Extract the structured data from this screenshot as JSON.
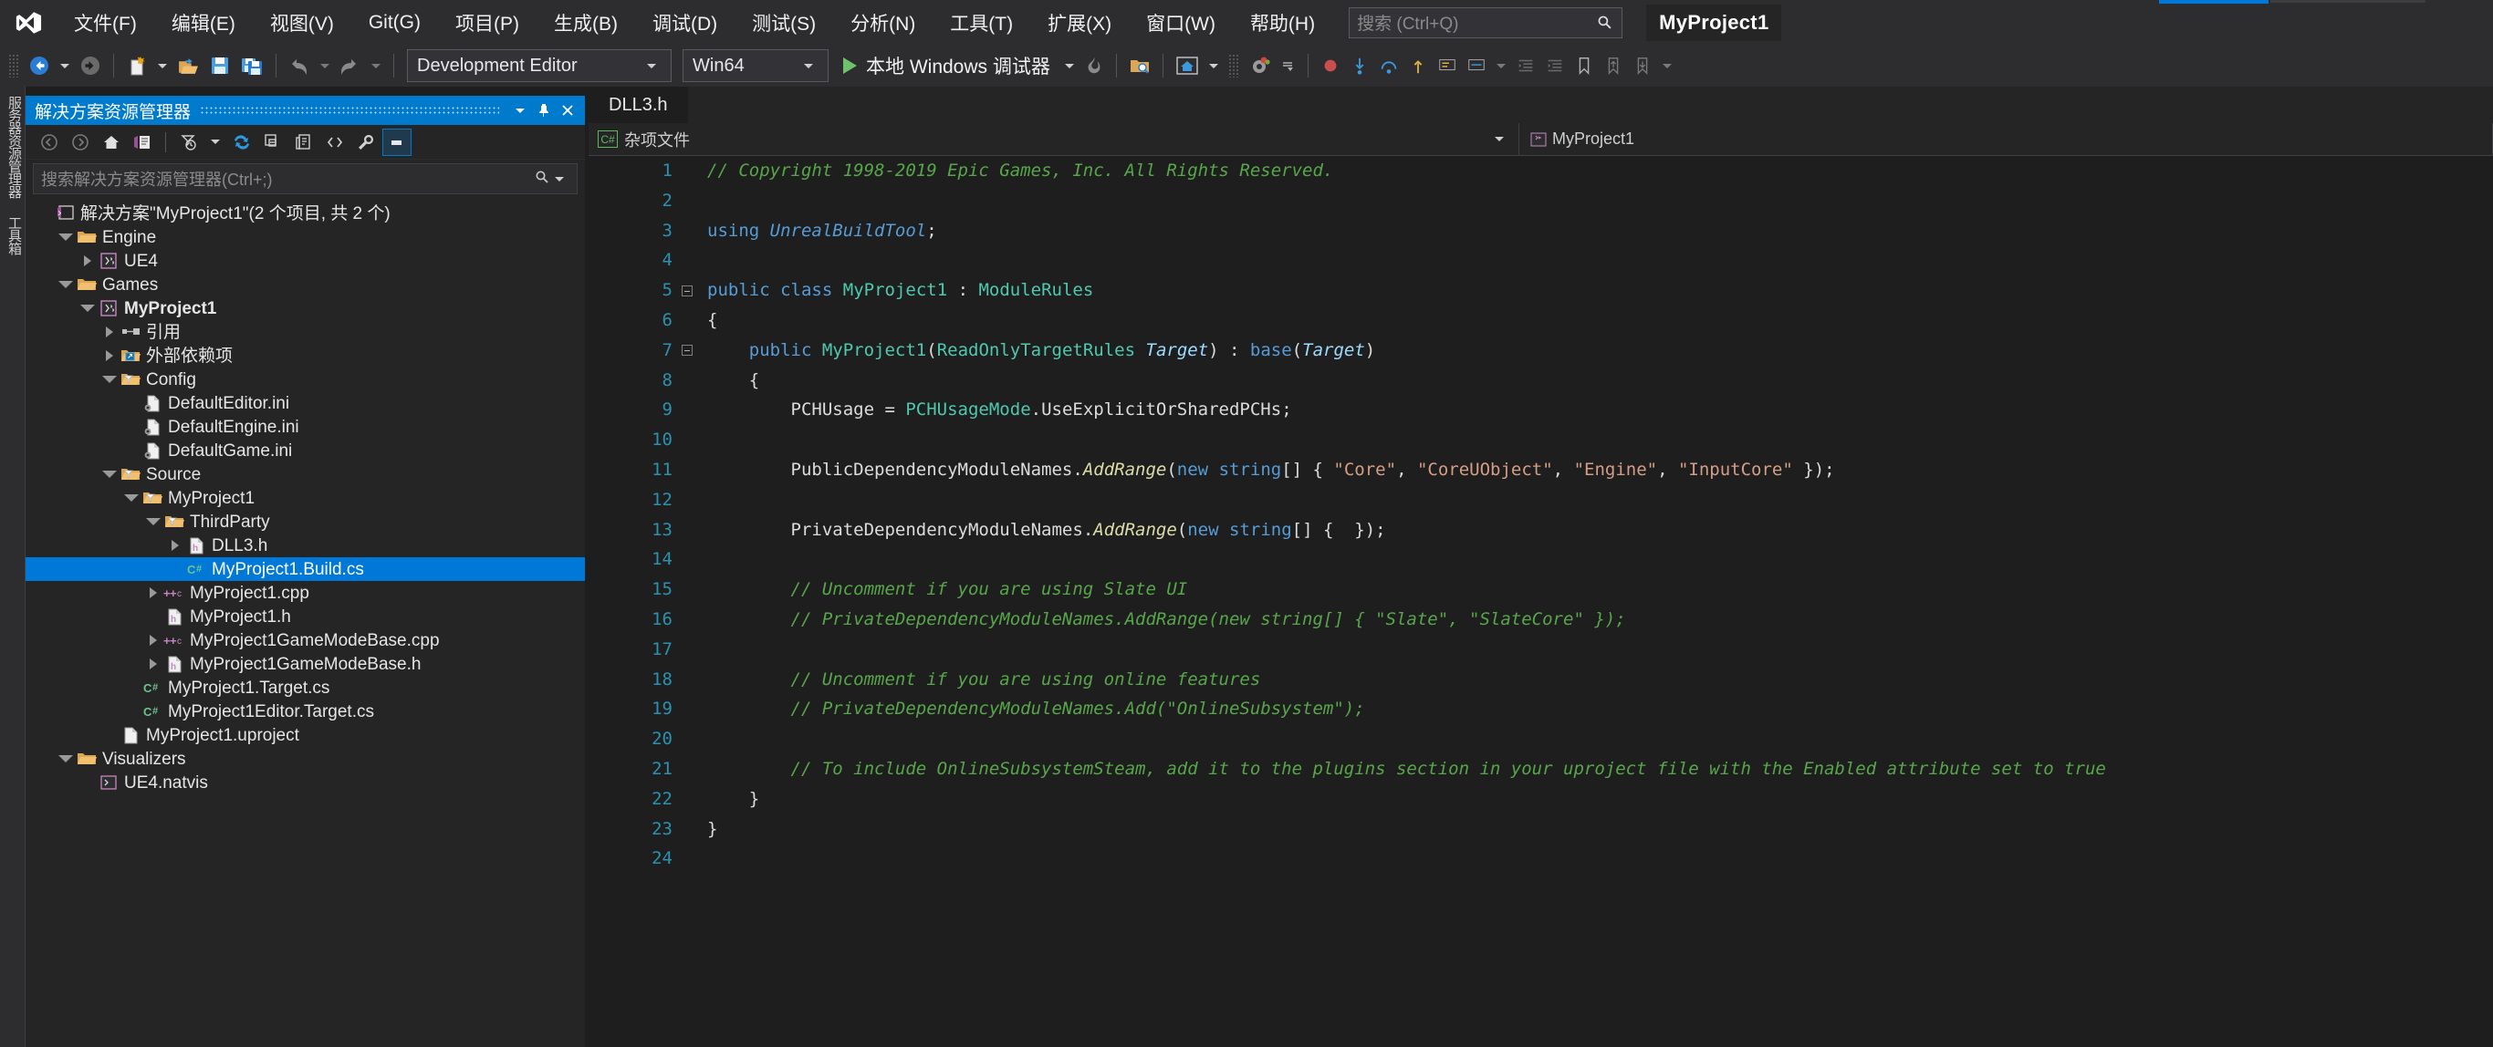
{
  "app": {
    "logo_icon": "visual-studio-logo-icon",
    "project_chip": "MyProject1"
  },
  "menubar": {
    "items": [
      {
        "label": "文件(F)",
        "name": "menu-file"
      },
      {
        "label": "编辑(E)",
        "name": "menu-edit"
      },
      {
        "label": "视图(V)",
        "name": "menu-view"
      },
      {
        "label": "Git(G)",
        "name": "menu-git"
      },
      {
        "label": "项目(P)",
        "name": "menu-project"
      },
      {
        "label": "生成(B)",
        "name": "menu-build"
      },
      {
        "label": "调试(D)",
        "name": "menu-debug"
      },
      {
        "label": "测试(S)",
        "name": "menu-test"
      },
      {
        "label": "分析(N)",
        "name": "menu-analyze"
      },
      {
        "label": "工具(T)",
        "name": "menu-tools"
      },
      {
        "label": "扩展(X)",
        "name": "menu-extensions"
      },
      {
        "label": "窗口(W)",
        "name": "menu-window"
      },
      {
        "label": "帮助(H)",
        "name": "menu-help"
      }
    ],
    "search_placeholder": "搜索 (Ctrl+Q)",
    "search_icon": "search-icon"
  },
  "toolbar": {
    "back_icon": "navigate-back-icon",
    "forward_icon": "navigate-forward-icon",
    "new_item_icon": "new-item-icon",
    "open_icon": "open-file-icon",
    "save_icon": "save-icon",
    "save_all_icon": "save-all-icon",
    "undo_icon": "undo-icon",
    "redo_icon": "redo-icon",
    "configuration": "Development Editor",
    "platform": "Win64",
    "run_label": "本地 Windows 调试器",
    "run_icon": "play-icon",
    "hot_reload_icon": "hot-reload-icon",
    "folder_search_icon": "folder-search-icon",
    "home_icon": "home-frame-icon",
    "settings_icon": "settings-gear-icon"
  },
  "vtabs": [
    {
      "label": "服务器资源管理器",
      "name": "vtab-server-explorer"
    },
    {
      "label": "工具箱",
      "name": "vtab-toolbox"
    }
  ],
  "solution_explorer": {
    "title": "解决方案资源管理器",
    "dropdown_icon": "chevron-down-icon",
    "pin_icon": "pin-icon",
    "close_icon": "close-icon",
    "toolbar_icons": [
      "back-icon",
      "forward-icon",
      "home-icon",
      "solution-properties-icon",
      "pending-changes-filter-icon",
      "chevron-down-icon",
      "refresh-icon",
      "collapse-all-icon",
      "show-all-files-icon",
      "view-code-icon",
      "properties-wrench-icon",
      "preview-pane-icon"
    ],
    "search_placeholder": "搜索解决方案资源管理器(Ctrl+;)",
    "search_icon": "search-icon",
    "tree": [
      {
        "label": "解决方案\"MyProject1\"(2 个项目, 共 2 个)",
        "depth": 0,
        "twist": "none",
        "icon": "solution-icon",
        "bold": false,
        "selected": false
      },
      {
        "label": "Engine",
        "depth": 1,
        "twist": "open",
        "icon": "folder-icon",
        "bold": false,
        "selected": false
      },
      {
        "label": "UE4",
        "depth": 2,
        "twist": "closed",
        "icon": "project-icon",
        "bold": false,
        "selected": false
      },
      {
        "label": "Games",
        "depth": 1,
        "twist": "open",
        "icon": "folder-icon",
        "bold": false,
        "selected": false
      },
      {
        "label": "MyProject1",
        "depth": 2,
        "twist": "open",
        "icon": "project-icon",
        "bold": true,
        "selected": false
      },
      {
        "label": "引用",
        "depth": 3,
        "twist": "closed",
        "icon": "references-icon",
        "bold": false,
        "selected": false
      },
      {
        "label": "外部依赖项",
        "depth": 3,
        "twist": "closed",
        "icon": "external-deps-icon",
        "bold": false,
        "selected": false
      },
      {
        "label": "Config",
        "depth": 3,
        "twist": "open",
        "icon": "filter-folder-icon",
        "bold": false,
        "selected": false
      },
      {
        "label": "DefaultEditor.ini",
        "depth": 4,
        "twist": "none",
        "icon": "ini-file-icon",
        "bold": false,
        "selected": false
      },
      {
        "label": "DefaultEngine.ini",
        "depth": 4,
        "twist": "none",
        "icon": "ini-file-icon",
        "bold": false,
        "selected": false
      },
      {
        "label": "DefaultGame.ini",
        "depth": 4,
        "twist": "none",
        "icon": "ini-file-icon",
        "bold": false,
        "selected": false
      },
      {
        "label": "Source",
        "depth": 3,
        "twist": "open",
        "icon": "filter-folder-icon",
        "bold": false,
        "selected": false
      },
      {
        "label": "MyProject1",
        "depth": 4,
        "twist": "open",
        "icon": "filter-folder-icon",
        "bold": false,
        "selected": false
      },
      {
        "label": "ThirdParty",
        "depth": 5,
        "twist": "open",
        "icon": "filter-folder-icon",
        "bold": false,
        "selected": false
      },
      {
        "label": "DLL3.h",
        "depth": 6,
        "twist": "closed",
        "icon": "header-file-icon",
        "bold": false,
        "selected": false
      },
      {
        "label": "MyProject1.Build.cs",
        "depth": 6,
        "twist": "none",
        "icon": "csharp-file-icon",
        "bold": false,
        "selected": true
      },
      {
        "label": "MyProject1.cpp",
        "depth": 5,
        "twist": "closed",
        "icon": "cpp-file-icon",
        "bold": false,
        "selected": false
      },
      {
        "label": "MyProject1.h",
        "depth": 5,
        "twist": "none",
        "icon": "header-file-icon",
        "bold": false,
        "selected": false
      },
      {
        "label": "MyProject1GameModeBase.cpp",
        "depth": 5,
        "twist": "closed",
        "icon": "cpp-file-icon",
        "bold": false,
        "selected": false
      },
      {
        "label": "MyProject1GameModeBase.h",
        "depth": 5,
        "twist": "closed",
        "icon": "header-file-icon",
        "bold": false,
        "selected": false
      },
      {
        "label": "MyProject1.Target.cs",
        "depth": 4,
        "twist": "none",
        "icon": "csharp-file-icon",
        "bold": false,
        "selected": false
      },
      {
        "label": "MyProject1Editor.Target.cs",
        "depth": 4,
        "twist": "none",
        "icon": "csharp-file-icon",
        "bold": false,
        "selected": false
      },
      {
        "label": "MyProject1.uproject",
        "depth": 3,
        "twist": "none",
        "icon": "generic-file-icon",
        "bold": false,
        "selected": false
      },
      {
        "label": "Visualizers",
        "depth": 1,
        "twist": "open",
        "icon": "folder-icon",
        "bold": false,
        "selected": false
      },
      {
        "label": "UE4.natvis",
        "depth": 2,
        "twist": "none",
        "icon": "natvis-file-icon",
        "bold": false,
        "selected": false
      }
    ]
  },
  "editor": {
    "tab_label": "DLL3.h",
    "nav_left": "杂项文件",
    "nav_left_badge": "C#",
    "nav_right": "MyProject1",
    "nav_right_icon": "project-icon",
    "nav_caret_icon": "chevron-down-icon",
    "line_numbers": [
      1,
      2,
      3,
      4,
      5,
      6,
      7,
      8,
      9,
      10,
      11,
      12,
      13,
      14,
      15,
      16,
      17,
      18,
      19,
      20,
      21,
      22,
      23,
      24
    ],
    "lines": [
      "// Copyright 1998-2019 Epic Games, Inc. All Rights Reserved.",
      "",
      "using UnrealBuildTool;",
      "",
      "public class MyProject1 : ModuleRules",
      "{",
      "    public MyProject1(ReadOnlyTargetRules Target) : base(Target)",
      "    {",
      "        PCHUsage = PCHUsageMode.UseExplicitOrSharedPCHs;",
      "",
      "        PublicDependencyModuleNames.AddRange(new string[] { \"Core\", \"CoreUObject\", \"Engine\", \"InputCore\" });",
      "",
      "        PrivateDependencyModuleNames.AddRange(new string[] {  });",
      "",
      "        // Uncomment if you are using Slate UI",
      "        // PrivateDependencyModuleNames.AddRange(new string[] { \"Slate\", \"SlateCore\" });",
      "",
      "        // Uncomment if you are using online features",
      "        // PrivateDependencyModuleNames.Add(\"OnlineSubsystem\");",
      "",
      "        // To include OnlineSubsystemSteam, add it to the plugins section in your uproject file with the Enabled attribute set to true",
      "    }",
      "}",
      ""
    ]
  },
  "colors": {
    "accent": "#007acc",
    "menubar_bg": "#2d2d30",
    "editor_bg": "#1e1e1e",
    "panel_bg": "#252526",
    "selection": "#0078d7",
    "comment": "#57a64a",
    "keyword": "#569cd6",
    "type": "#4ec9b0",
    "string": "#d69d85",
    "linenum": "#2b91af"
  }
}
